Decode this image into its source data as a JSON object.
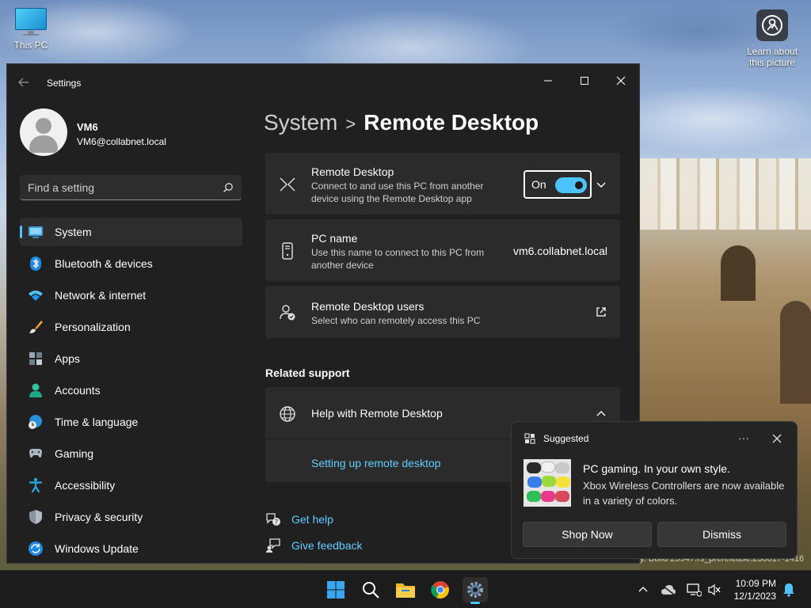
{
  "desktop": {
    "this_pc_label": "This PC",
    "learn_label_line1": "Learn about",
    "learn_label_line2": "this picture"
  },
  "window": {
    "title": "Settings",
    "minimize_icon": "minimize-icon",
    "maximize_icon": "maximize-icon",
    "close_icon": "close-icon"
  },
  "profile": {
    "name": "VM6",
    "email": "VM6@collabnet.local"
  },
  "search": {
    "placeholder": "Find a setting"
  },
  "nav": {
    "items": [
      {
        "label": "System",
        "icon": "system-icon",
        "active": true
      },
      {
        "label": "Bluetooth & devices",
        "icon": "bluetooth-icon"
      },
      {
        "label": "Network & internet",
        "icon": "wifi-icon"
      },
      {
        "label": "Personalization",
        "icon": "brush-icon"
      },
      {
        "label": "Apps",
        "icon": "apps-icon"
      },
      {
        "label": "Accounts",
        "icon": "accounts-icon"
      },
      {
        "label": "Time & language",
        "icon": "globe-clock-icon"
      },
      {
        "label": "Gaming",
        "icon": "gamepad-icon"
      },
      {
        "label": "Accessibility",
        "icon": "accessibility-icon"
      },
      {
        "label": "Privacy & security",
        "icon": "shield-icon"
      },
      {
        "label": "Windows Update",
        "icon": "update-icon"
      }
    ]
  },
  "breadcrumb": {
    "parent": "System",
    "separator": ">",
    "current": "Remote Desktop"
  },
  "remote_desktop": {
    "title": "Remote Desktop",
    "desc": "Connect to and use this PC from another device using the Remote Desktop app",
    "toggle_label": "On",
    "toggle_state": true
  },
  "pc_name": {
    "title": "PC name",
    "desc": "Use this name to connect to this PC from another device",
    "value": "vm6.collabnet.local"
  },
  "rd_users": {
    "title": "Remote Desktop users",
    "desc": "Select who can remotely access this PC"
  },
  "related": {
    "heading": "Related support",
    "help_title": "Help with Remote Desktop",
    "help_link": "Setting up remote desktop"
  },
  "footer": {
    "get_help": "Get help",
    "give_feedback": "Give feedback"
  },
  "toast": {
    "tag": "Suggested",
    "more": "···",
    "title": "PC gaming. In your own style.",
    "body": "Xbox Wireless Controllers are now available in a variety of colors.",
    "primary": "Shop Now",
    "secondary": "Dismiss"
  },
  "build_text": "y. Build 25947.rs_prerelease.230817-1416",
  "taskbar": {
    "time": "10:09 PM",
    "date": "12/1/2023"
  },
  "colors": {
    "accent": "#4cc2ff",
    "link": "#60cdff",
    "window_bg": "#202020",
    "card_bg": "#2b2b2b"
  }
}
